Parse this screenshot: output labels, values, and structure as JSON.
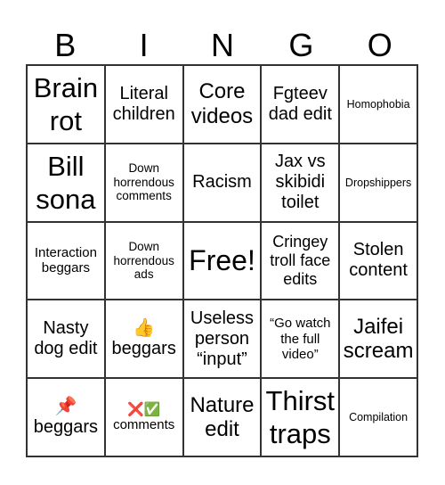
{
  "header": {
    "letters": [
      "B",
      "I",
      "N",
      "G",
      "O"
    ]
  },
  "cells": [
    {
      "text": "Brain rot",
      "size": "s-xl"
    },
    {
      "text": "Literal children",
      "size": "s-m"
    },
    {
      "text": "Core videos",
      "size": "s-l"
    },
    {
      "text": "Fgteev dad edit",
      "size": "s-m"
    },
    {
      "text": "Homophobia",
      "size": "s-xxs"
    },
    {
      "text": "Bill sona",
      "size": "s-xl"
    },
    {
      "text": "Down horrendous comments",
      "size": "s-xs"
    },
    {
      "text": "Racism",
      "size": "s-m"
    },
    {
      "text": "Jax vs skibidi toilet",
      "size": "s-m"
    },
    {
      "text": "Dropshippers",
      "size": "s-xxs"
    },
    {
      "text": "Interaction beggars",
      "size": "s-s"
    },
    {
      "text": "Down horrendous ads",
      "size": "s-xs"
    },
    {
      "text": "Free!",
      "size": "free"
    },
    {
      "text": "Cringey troll face edits",
      "size": "s-ms"
    },
    {
      "text": "Stolen content",
      "size": "s-m"
    },
    {
      "text": "Nasty dog edit",
      "size": "s-m"
    },
    {
      "text": "👍 beggars",
      "size": "s-m"
    },
    {
      "text": "Useless person “input”",
      "size": "s-m"
    },
    {
      "text": "“Go watch the full video”",
      "size": "s-s"
    },
    {
      "text": "Jaifei scream",
      "size": "s-l"
    },
    {
      "text": "📌 beggars",
      "size": "s-m"
    },
    {
      "text": "❌✅ comments",
      "size": "s-s"
    },
    {
      "text": "Nature edit",
      "size": "s-l"
    },
    {
      "text": "Thirst traps",
      "size": "s-xl"
    },
    {
      "text": "Compilation",
      "size": "s-xxs"
    }
  ]
}
